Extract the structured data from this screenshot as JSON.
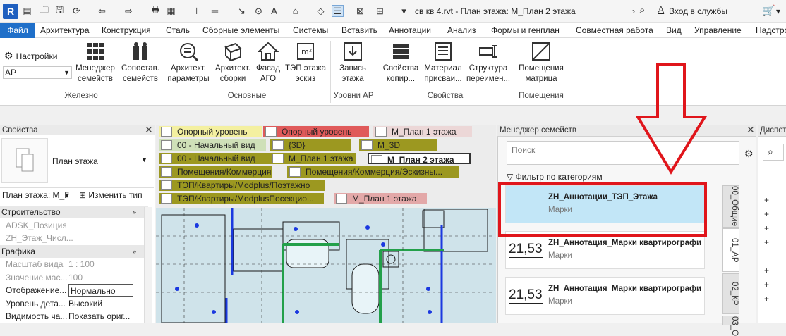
{
  "titlebar": {
    "logo": "R",
    "doc_title": "св кв 4.rvt - План этажа: М_План 2 этажа",
    "login": "Вход в службы",
    "icons": [
      "save-icon",
      "undo-icon",
      "redo-icon",
      "print-icon",
      "measure-icon",
      "text-icon",
      "home-icon",
      "sync-icon",
      "search-icon",
      "user-icon",
      "cart-icon"
    ]
  },
  "menu": {
    "file": "Файл",
    "tabs": [
      "Архитектура",
      "Конструкция",
      "Сталь",
      "Сборные элементы",
      "Системы",
      "Вставить",
      "Аннотации",
      "Анализ",
      "Формы и генплан",
      "Совместная работа",
      "Вид",
      "Управление",
      "Надстро"
    ]
  },
  "ribbon": {
    "settings_label": "Настройки",
    "settings_value": "АР",
    "buttons": [
      {
        "l1": "Менеджер",
        "l2": "семейств"
      },
      {
        "l1": "Сопостав.",
        "l2": "семейств"
      },
      {
        "l1": "Архитект.",
        "l2": "параметры"
      },
      {
        "l1": "Архитект.",
        "l2": "сборки"
      },
      {
        "l1": "Фасад",
        "l2": "АГО"
      },
      {
        "l1": "ТЭП этажа",
        "l2": "эскиз"
      },
      {
        "l1": "Запись",
        "l2": "этажа"
      },
      {
        "l1": "Свойства",
        "l2": "копир..."
      },
      {
        "l1": "Материал",
        "l2": "присваи..."
      },
      {
        "l1": "Структура",
        "l2": "переимен..."
      },
      {
        "l1": "Помещения",
        "l2": "матрица"
      }
    ],
    "groups": [
      "Железно",
      "Основные",
      "Уровни АР",
      "Свойства",
      "Помещения"
    ]
  },
  "properties": {
    "title": "Свойства",
    "type": "План этажа",
    "selector": "План этажа: М_Г",
    "edit_type": "Изменить тип",
    "rows": [
      {
        "k": "Строительство",
        "v": "",
        "header": true
      },
      {
        "k": "ADSK_Позиция",
        "v": "",
        "dim": true
      },
      {
        "k": "ZH_Этаж_Числ...",
        "v": "",
        "dim": true
      },
      {
        "k": "Графика",
        "v": "",
        "header": true
      },
      {
        "k": "Масштаб вида",
        "v": "1 : 100",
        "dim": true
      },
      {
        "k": "Значение мас...",
        "v": "100",
        "dim": true
      },
      {
        "k": "Отображение...",
        "v": "Нормально",
        "box": true
      },
      {
        "k": "Уровень дета...",
        "v": "Высокий"
      },
      {
        "k": "Видимость ча...",
        "v": "Показать ориг..."
      }
    ]
  },
  "views": {
    "tabs": [
      {
        "label": "Опорный уровень",
        "color": "#f4f0a0"
      },
      {
        "label": "Опорный уровень",
        "color": "#e05a5a"
      },
      {
        "label": "М_План 1 этажа",
        "color": "#ecd7d7"
      },
      {
        "label": "00 - Начальный вид",
        "color": "#cfe0b8"
      },
      {
        "label": "{3D}",
        "color": "#9c9820"
      },
      {
        "label": "М_3D",
        "color": "#9c9820"
      },
      {
        "label": "00 - Начальный вид",
        "color": "#9c9820"
      },
      {
        "label": "М_План 1 этажа",
        "color": "#9c9820"
      },
      {
        "label": "М_План 2 этажа",
        "color": "#9c9820"
      },
      {
        "label": "Помещения/Коммерция",
        "color": "#9c9820"
      },
      {
        "label": "Помещения/Коммерция/Эскизны...",
        "color": "#9c9820"
      },
      {
        "label": "ТЭП/Квартиры/Modplus/Поэтажно",
        "color": "#9c9820"
      },
      {
        "label": "ТЭП/Квартиры/ModplusПосекцио...",
        "color": "#9c9820"
      },
      {
        "label": "М_План 1 этажа",
        "color": "#e3a8a8"
      }
    ]
  },
  "family_manager": {
    "title": "Менеджер семейств",
    "search_placeholder": "Поиск",
    "filter": "Фильтр по категориям",
    "cards": [
      {
        "name": "ZH_Аннотации_ТЭП_Этажа",
        "category": "Марки",
        "thumb": "",
        "selected": true
      },
      {
        "name": "ZH_Аннотация_Марки квартирографи",
        "category": "Марки",
        "thumb": "21,53"
      },
      {
        "name": "ZH_Аннотация_Марки квартирографи",
        "category": "Марки",
        "thumb": "21,53"
      }
    ],
    "side_tabs": [
      "00_Общие",
      "01_АР",
      "02_КР",
      "03_О"
    ]
  },
  "dispatcher": {
    "title": "Диспет"
  },
  "colors": {
    "accent": "#1f6fc9",
    "annotation_red": "#e0151b",
    "selected_card": "#c2e6f7"
  }
}
